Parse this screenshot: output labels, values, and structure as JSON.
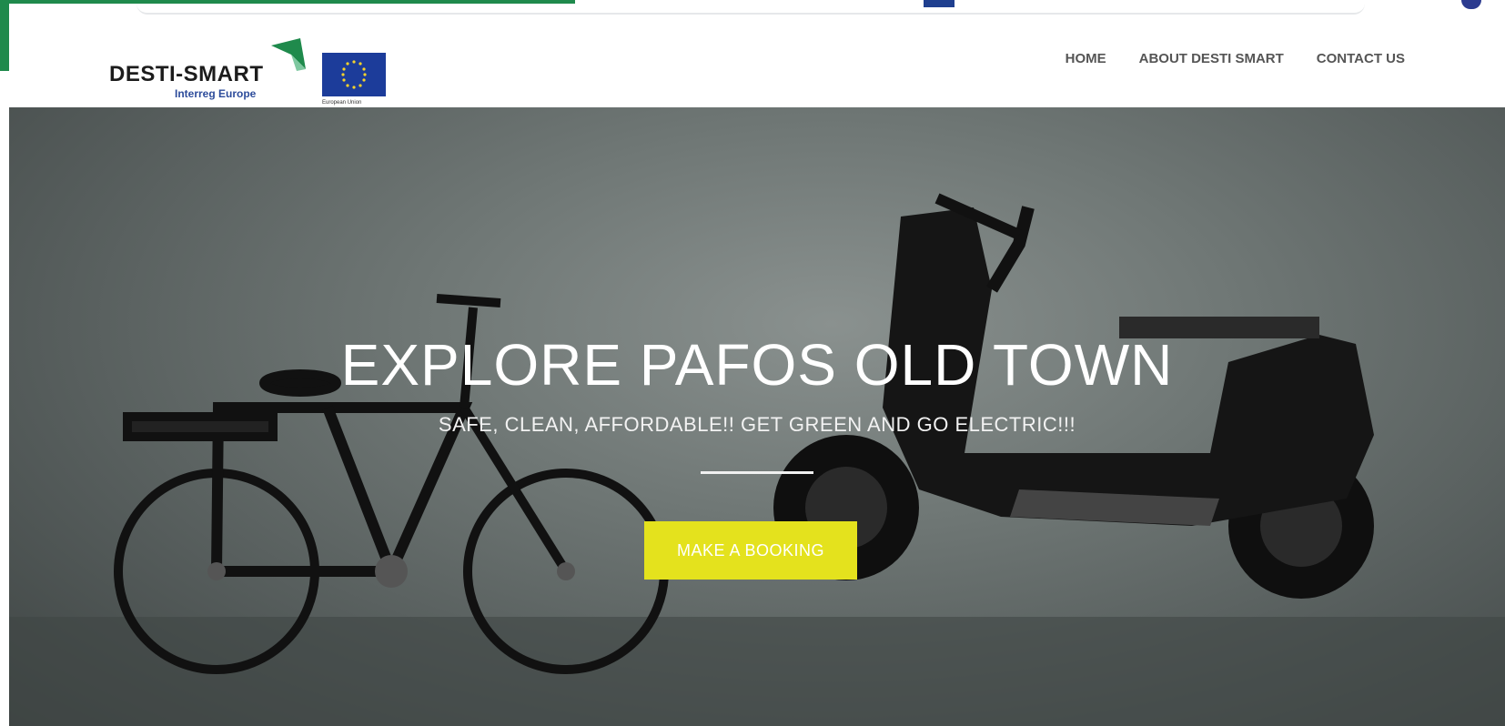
{
  "brand": {
    "name": "DESTI-SMART",
    "subtitle": "Interreg Europe",
    "eu_caption": "European Union",
    "colors": {
      "green": "#1f8a4c",
      "eu_blue": "#1c3c9a",
      "accent": "#e4e21d"
    }
  },
  "nav": {
    "items": [
      {
        "label": "HOME"
      },
      {
        "label": "ABOUT DESTI SMART"
      },
      {
        "label": "CONTACT US"
      }
    ]
  },
  "hero": {
    "title": "EXPLORE PAFOS OLD TOWN",
    "subtitle": "SAFE, CLEAN, AFFORDABLE!! GET GREEN AND GO ELECTRIC!!!",
    "cta_label": "MAKE A BOOKING",
    "icons": [
      "bicycle-image",
      "scooter-image"
    ]
  }
}
